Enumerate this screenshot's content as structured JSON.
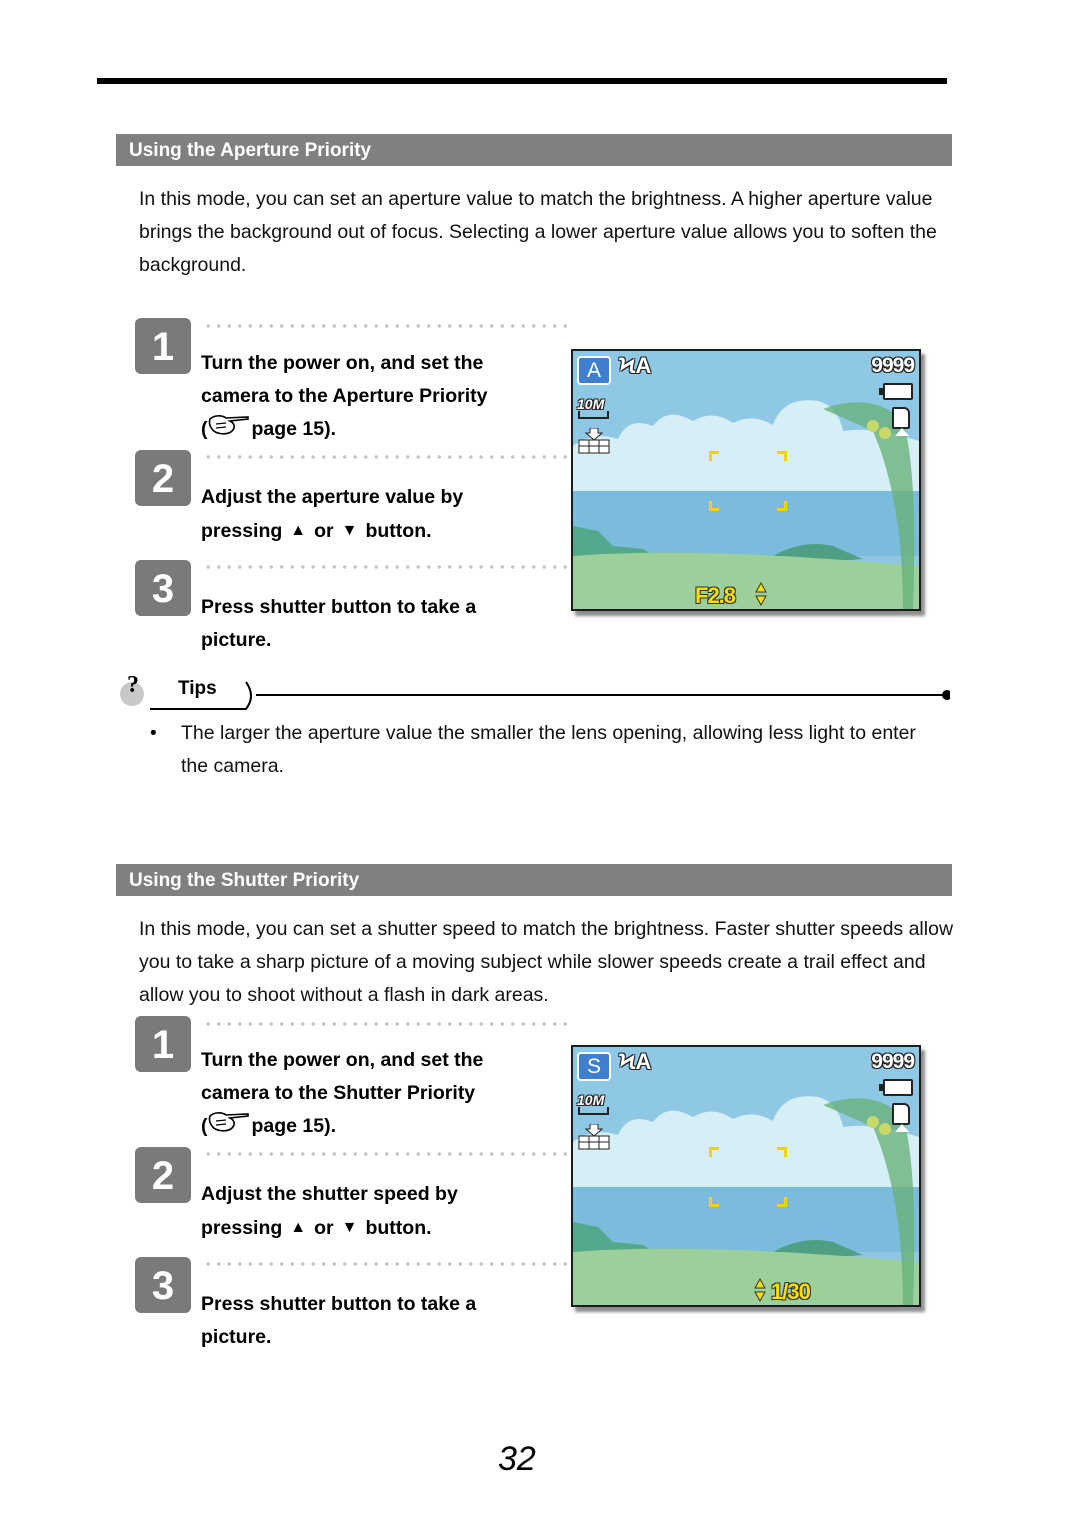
{
  "sections": [
    {
      "title": "Using the Aperture Priority",
      "intro": "In this mode, you can set an aperture value to match the brightness. A higher aperture value brings the background out of focus. Selecting a lower aperture value allows you to soften the background.",
      "steps": [
        {
          "number": "1",
          "text_line1": "Turn the power on, and set the",
          "text_line2": "camera to the Aperture Priority",
          "text_line3_prefix": "(",
          "text_line3": "page 15)."
        },
        {
          "number": "2",
          "text_line1": "Adjust the aperture value by",
          "pressing": "pressing",
          "up_symbol": "▲",
          "or": "or",
          "down_symbol": "▼",
          "button": "button."
        },
        {
          "number": "3",
          "text_line1": "Press shutter button to take a",
          "text_line2": "picture."
        }
      ],
      "screen": {
        "mode": "A",
        "flash": "ϞA",
        "shots_remaining": "9999",
        "resolution": "10M",
        "value_label": "F2.8",
        "value_position": "left-of-arrows"
      }
    },
    {
      "title": "Using the Shutter Priority",
      "intro": "In this mode, you can set a shutter speed to match the brightness. Faster shutter speeds allow you to take a sharp picture of a moving subject while slower speeds create a trail effect and allow you to shoot without a flash in dark areas.",
      "steps": [
        {
          "number": "1",
          "text_line1": "Turn the power on, and set the",
          "text_line2": "camera to the Shutter Priority",
          "text_line3_prefix": "(",
          "text_line3": "page 15)."
        },
        {
          "number": "2",
          "text_line1": "Adjust the shutter speed by",
          "pressing": "pressing",
          "up_symbol": "▲",
          "or": "or",
          "down_symbol": "▼",
          "button": "button."
        },
        {
          "number": "3",
          "text_line1": "Press shutter button to take a",
          "text_line2": "picture."
        }
      ],
      "screen": {
        "mode": "S",
        "flash": "ϞA",
        "shots_remaining": "9999",
        "resolution": "10M",
        "value_label": "1/30",
        "value_position": "right-of-arrows"
      }
    }
  ],
  "tips": {
    "label": "Tips",
    "items": [
      "The larger the aperture value the smaller the lens opening, allowing less light to enter the camera."
    ]
  },
  "page_number": "32",
  "colors": {
    "section_bar": "#808080",
    "step_badge": "#7a7a7a",
    "mode_badge": "#3f7fd0",
    "osd_value": "#f5e000"
  }
}
